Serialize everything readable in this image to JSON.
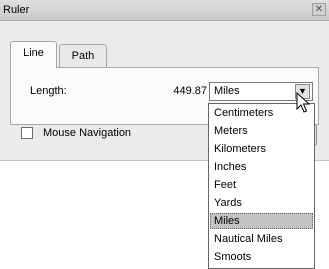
{
  "window": {
    "title": "Ruler",
    "close_glyph": "✕"
  },
  "tabs": [
    {
      "label": "Line",
      "active": true
    },
    {
      "label": "Path",
      "active": false
    }
  ],
  "length": {
    "label": "Length:",
    "value": "449.87"
  },
  "units": {
    "selected": "Miles",
    "arrow_glyph": "▼",
    "options": [
      "Centimeters",
      "Meters",
      "Kilometers",
      "Inches",
      "Feet",
      "Yards",
      "Miles",
      "Nautical Miles",
      "Smoots"
    ],
    "highlighted_index": 6
  },
  "mouse_navigation": {
    "label": "Mouse Navigation",
    "checked": false
  },
  "icons": {
    "cursor": "arrow-pointer-icon",
    "close": "close-icon",
    "dropdown": "chevron-down-icon"
  }
}
